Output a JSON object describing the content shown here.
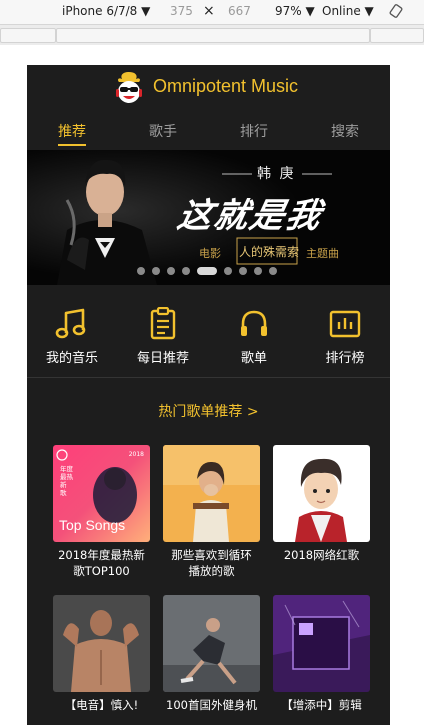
{
  "devtools": {
    "device": "iPhone 6/7/8 ▼",
    "width": "375",
    "times": "×",
    "height": "667",
    "zoom": "97% ▼",
    "network": "Online ▼"
  },
  "app": {
    "brand": "Omnipotent Music",
    "tabs": [
      {
        "label": "推荐",
        "active": true
      },
      {
        "label": "歌手",
        "active": false
      },
      {
        "label": "排行",
        "active": false
      },
      {
        "label": "搜索",
        "active": false
      }
    ],
    "banner": {
      "artist": "韩 庚",
      "slogan": "这就是我",
      "sub_left": "电影",
      "sub_film": "人的殊需索",
      "sub_right": "主题曲",
      "slide_count": 9,
      "active_slide": 4
    },
    "categories": [
      {
        "label": "我的音乐",
        "icon": "music-note-icon"
      },
      {
        "label": "每日推荐",
        "icon": "clipboard-list-icon"
      },
      {
        "label": "歌单",
        "icon": "headphones-icon"
      },
      {
        "label": "排行榜",
        "icon": "bar-chart-icon"
      }
    ],
    "section_title": "热门歌单推荐 >",
    "playlists": [
      {
        "line1": "2018年度最热新",
        "line2": "歌TOP100",
        "cover_title": "Top Songs",
        "cover_year": "2018",
        "cover_lines": [
          "年",
          "度",
          "最",
          "热",
          "新",
          "歌"
        ]
      },
      {
        "line1": "那些喜欢到循环",
        "line2": "播放的歌"
      },
      {
        "line1": "2018网络红歌",
        "line2": ""
      },
      {
        "line1": "【电音】慎入!",
        "line2": ""
      },
      {
        "line1": "100首国外健身机",
        "line2": ""
      },
      {
        "line1": "【增添中】剪辑",
        "line2": ""
      }
    ]
  },
  "colors": {
    "accent": "#f2c12e",
    "background": "#1d1d1d"
  }
}
